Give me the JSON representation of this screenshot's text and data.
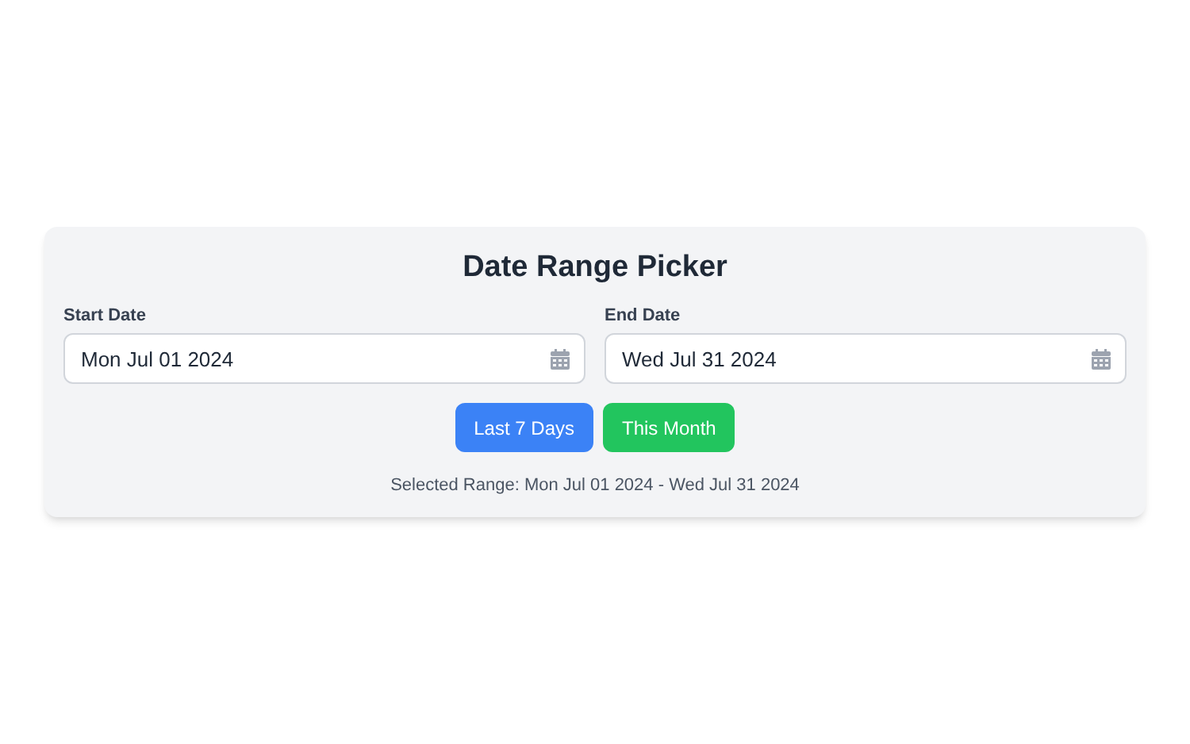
{
  "title": "Date Range Picker",
  "fields": [
    {
      "label": "Start Date",
      "value": "Mon Jul 01 2024"
    },
    {
      "label": "End Date",
      "value": "Wed Jul 31 2024"
    }
  ],
  "buttons": [
    {
      "label": "Last 7 Days",
      "color": "#3b82f6"
    },
    {
      "label": "This Month",
      "color": "#22c55e"
    }
  ],
  "selected_range": "Selected Range: Mon Jul 01 2024 - Wed Jul 31 2024"
}
